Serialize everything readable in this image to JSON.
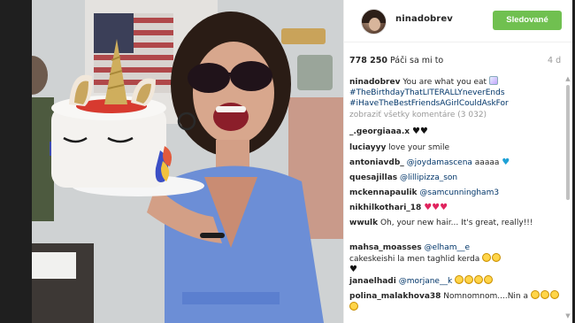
{
  "post": {
    "username": "ninadobrev",
    "follow_label": "Sledované",
    "likes_count": "778 250",
    "likes_label": " Páči sa mi to",
    "time_ago": "4 d"
  },
  "caption": {
    "user": "ninadobrev",
    "text": " You are what you eat ",
    "tag1": "#TheBirthdayThatLITERALLYneverEnds",
    "tag2": "#iHaveTheBestFriendsAGirlCouldAskFor"
  },
  "view_all_label": "zobraziť všetky komentáre (3 032)",
  "comments": [
    {
      "user": "_.georgiaaa.x",
      "text": ""
    },
    {
      "user": "luciayyy",
      "text": " love your smile"
    },
    {
      "user": "antoniavdb_",
      "mention": "@joydamascena",
      "text": " aaaaa "
    },
    {
      "user": "quesajillas",
      "mention": "@lillipizza_son",
      "text": ""
    },
    {
      "user": "mckennapaulik",
      "mention": "@samcunningham3",
      "text": ""
    },
    {
      "user": "nikhilkothari_18",
      "text": " "
    },
    {
      "user": "wwulk",
      "text": " Oh, your new hair... It's great, really!!!"
    },
    {
      "user": "mahsa_moasses",
      "mention": "@elham__e",
      "text": "cakeskeishi la men taghlid kerda"
    },
    {
      "user": "janaelhadi",
      "mention": "@morjane__k",
      "text": ""
    },
    {
      "user": "polina_malakhova38",
      "text": " Nomnomnom....Nin a"
    }
  ],
  "icons": {
    "unicorn_emoji": "unicorn-emoji",
    "heart_red": "red-heart-icon",
    "heart_black": "black-heart-icon",
    "heart_blue": "blue-heart-icon",
    "laugh_emoji": "laughing-emoji-icon"
  },
  "colors": {
    "follow_button": "#70c050",
    "hashtag": "#003569",
    "muted": "#999999"
  }
}
